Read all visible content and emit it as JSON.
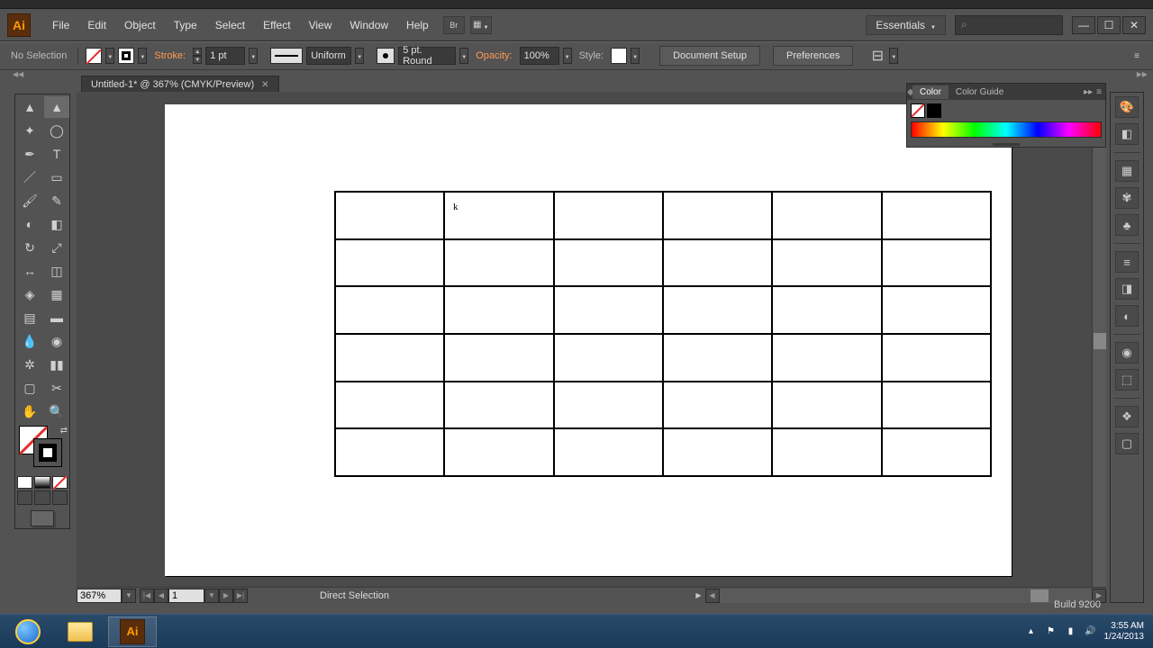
{
  "menubar": {
    "items": [
      "File",
      "Edit",
      "Object",
      "Type",
      "Select",
      "Effect",
      "View",
      "Window",
      "Help"
    ],
    "workspace": "Essentials",
    "search_placeholder": ""
  },
  "controlbar": {
    "selection": "No Selection",
    "stroke_label": "Stroke:",
    "stroke_weight": "1 pt",
    "profile": "Uniform",
    "brush": "5 pt. Round",
    "opacity_label": "Opacity:",
    "opacity_value": "100%",
    "style_label": "Style:",
    "doc_setup": "Document Setup",
    "preferences": "Preferences"
  },
  "document": {
    "tab_title": "Untitled-1* @ 367% (CMYK/Preview)",
    "cursor_char": "k",
    "grid": {
      "rows": 6,
      "cols": 6
    }
  },
  "status": {
    "zoom": "367%",
    "page": "1",
    "tool": "Direct Selection"
  },
  "color_panel": {
    "tabs": [
      "Color",
      "Color Guide"
    ],
    "active_tab": 0
  },
  "tray": {
    "time": "3:55 AM",
    "date": "1/24/2013"
  },
  "build_text": "Build 9200"
}
